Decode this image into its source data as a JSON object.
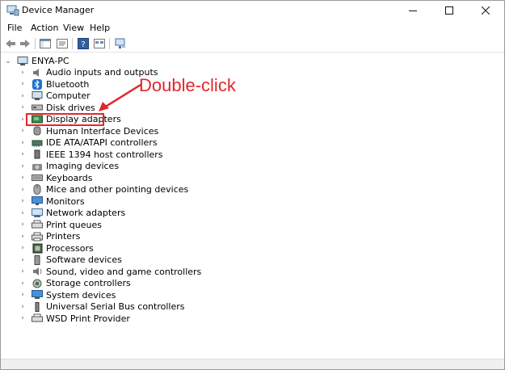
{
  "window": {
    "title": "Device Manager"
  },
  "menu": [
    "File",
    "Action",
    "View",
    "Help"
  ],
  "toolbar": [
    "back-icon",
    "forward-icon",
    "console-tree-icon",
    "properties-icon",
    "help-icon",
    "view-icon",
    "scan-hardware-icon"
  ],
  "tree": {
    "root": "ENYA-PC",
    "items": [
      {
        "label": "Audio inputs and outputs",
        "icon": "speaker-icon"
      },
      {
        "label": "Bluetooth",
        "icon": "bluetooth-icon"
      },
      {
        "label": "Computer",
        "icon": "computer-icon"
      },
      {
        "label": "Disk drives",
        "icon": "disk-drive-icon"
      },
      {
        "label": "Display adapters",
        "icon": "display-adapter-icon"
      },
      {
        "label": "Human Interface Devices",
        "icon": "hid-icon"
      },
      {
        "label": "IDE ATA/ATAPI controllers",
        "icon": "ide-controller-icon"
      },
      {
        "label": "IEEE 1394 host controllers",
        "icon": "ieee1394-icon"
      },
      {
        "label": "Imaging devices",
        "icon": "camera-icon"
      },
      {
        "label": "Keyboards",
        "icon": "keyboard-icon"
      },
      {
        "label": "Mice and other pointing devices",
        "icon": "mouse-icon"
      },
      {
        "label": "Monitors",
        "icon": "monitor-icon"
      },
      {
        "label": "Network adapters",
        "icon": "network-adapter-icon"
      },
      {
        "label": "Print queues",
        "icon": "print-queue-icon"
      },
      {
        "label": "Printers",
        "icon": "printer-icon"
      },
      {
        "label": "Processors",
        "icon": "processor-icon"
      },
      {
        "label": "Software devices",
        "icon": "software-device-icon"
      },
      {
        "label": "Sound, video and game controllers",
        "icon": "sound-icon"
      },
      {
        "label": "Storage controllers",
        "icon": "storage-controller-icon"
      },
      {
        "label": "System devices",
        "icon": "system-device-icon"
      },
      {
        "label": "Universal Serial Bus controllers",
        "icon": "usb-icon"
      },
      {
        "label": "WSD Print Provider",
        "icon": "wsd-printer-icon"
      }
    ]
  },
  "annotation": {
    "text": "Double-click",
    "color": "#e3262d"
  }
}
